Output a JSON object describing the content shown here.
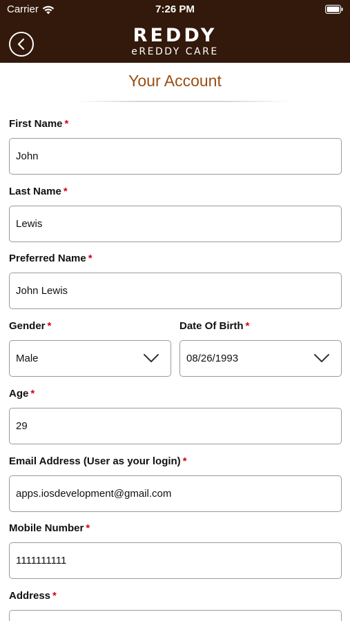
{
  "status_bar": {
    "carrier": "Carrier",
    "time": "7:26 PM"
  },
  "header": {
    "logo_title": "REDDY",
    "logo_subtitle": "eREDDY CARE",
    "background_color": "#33190b"
  },
  "page_title": "Your Account",
  "form": {
    "required_mark": "*",
    "first_name": {
      "label": "First Name",
      "value": "John"
    },
    "last_name": {
      "label": "Last Name",
      "value": "Lewis"
    },
    "preferred_name": {
      "label": "Preferred Name",
      "value": "John Lewis"
    },
    "gender": {
      "label": "Gender",
      "value": "Male"
    },
    "date_of_birth": {
      "label": "Date Of Birth",
      "value": "08/26/1993"
    },
    "age": {
      "label": "Age",
      "value": "29"
    },
    "email": {
      "label": "Email Address (User as your login)",
      "value": "apps.iosdevelopment@gmail.com"
    },
    "mobile": {
      "label": "Mobile Number",
      "value": "1111111111"
    },
    "address": {
      "label": "Address",
      "value": ""
    }
  }
}
